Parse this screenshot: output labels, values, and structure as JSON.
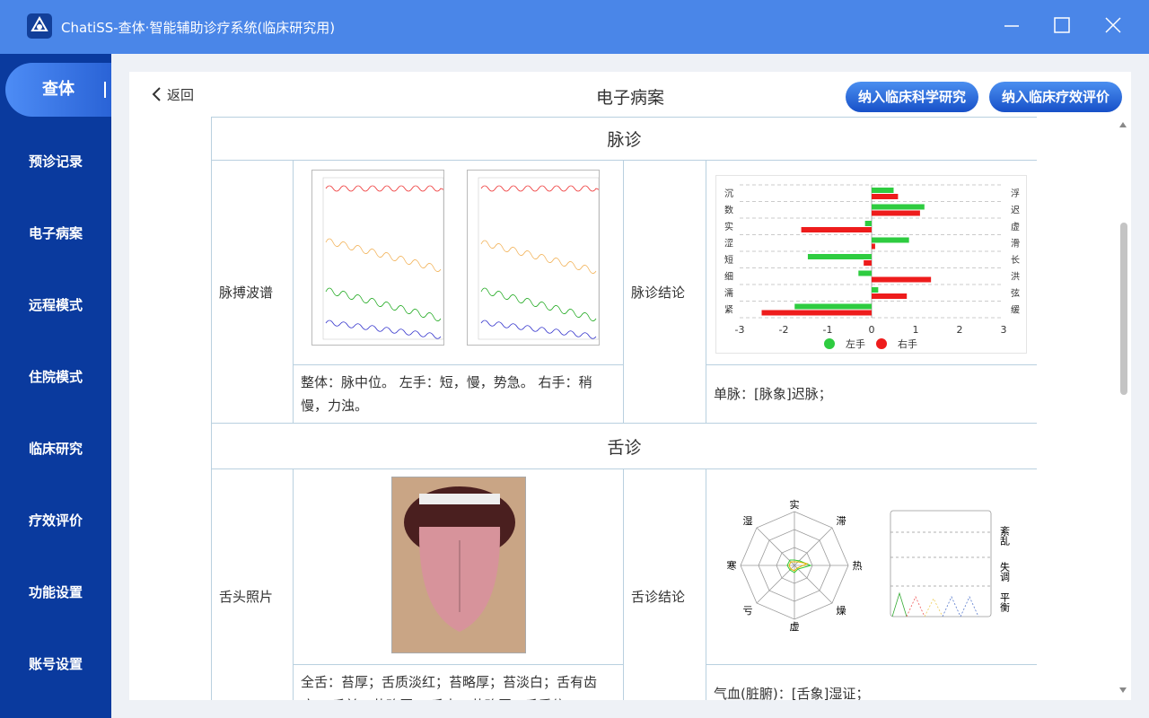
{
  "window": {
    "title": "ChatiSS-查体·智能辅助诊疗系统(临床研究用)"
  },
  "sidebar": {
    "items": [
      {
        "label": "查体",
        "active": true
      },
      {
        "label": "预诊记录"
      },
      {
        "label": "电子病案"
      },
      {
        "label": "远程模式"
      },
      {
        "label": "住院模式"
      },
      {
        "label": "临床研究"
      },
      {
        "label": "疗效评价"
      },
      {
        "label": "功能设置"
      },
      {
        "label": "账号设置"
      }
    ]
  },
  "header": {
    "back_label": "返回",
    "title": "电子病案",
    "btn_research": "纳入临床科学研究",
    "btn_evaluation": "纳入临床疗效评价"
  },
  "pulse": {
    "section_title": "脉诊",
    "wave_label": "脉搏波谱",
    "conclusion_label": "脉诊结论",
    "summary": "整体：脉中位。 左手：短，慢，势急。 右手：稍慢，力浊。",
    "conclusion": "单脉：[脉象]迟脉；",
    "legend_left": "左手",
    "legend_right": "右手"
  },
  "tongue": {
    "section_title": "舌诊",
    "photo_label": "舌头照片",
    "conclusion_label": "舌诊结论",
    "summary": "全舌：苔厚；舌质淡红；苔略厚；苔淡白；舌有齿痕。 舌前：苔略厚。 舌中：苔略厚；舌质偏",
    "conclusion": "气血(脏腑)：[舌象]湿证；",
    "radar_labels": [
      "实",
      "滞",
      "热",
      "燥",
      "虚",
      "亏",
      "寒",
      "湿"
    ],
    "side_labels": [
      "紊乱",
      "失调",
      "平衡"
    ]
  },
  "chart_data": {
    "type": "bar",
    "orientation": "horizontal",
    "categories_left": [
      "沉",
      "数",
      "实",
      "涩",
      "短",
      "细",
      "濡",
      "紧"
    ],
    "categories_right": [
      "浮",
      "迟",
      "虚",
      "滑",
      "长",
      "洪",
      "弦",
      "缓"
    ],
    "xlim": [
      -3,
      3
    ],
    "xticks": [
      -3,
      -2,
      -1,
      0,
      1,
      2,
      3
    ],
    "series": [
      {
        "name": "左手",
        "color": "#2ecc40",
        "values": [
          0.5,
          1.2,
          -0.15,
          0.85,
          -1.45,
          -0.3,
          0.15,
          -1.75
        ]
      },
      {
        "name": "右手",
        "color": "#ee1c1c",
        "values": [
          0.6,
          1.1,
          -1.6,
          0.08,
          -0.18,
          1.35,
          0.8,
          -2.5
        ]
      }
    ],
    "legend": "bottom"
  },
  "colors": {
    "titlebar": "#4a86e8",
    "sidebar": "#0a3a9e",
    "accent": "#2a63d6"
  }
}
